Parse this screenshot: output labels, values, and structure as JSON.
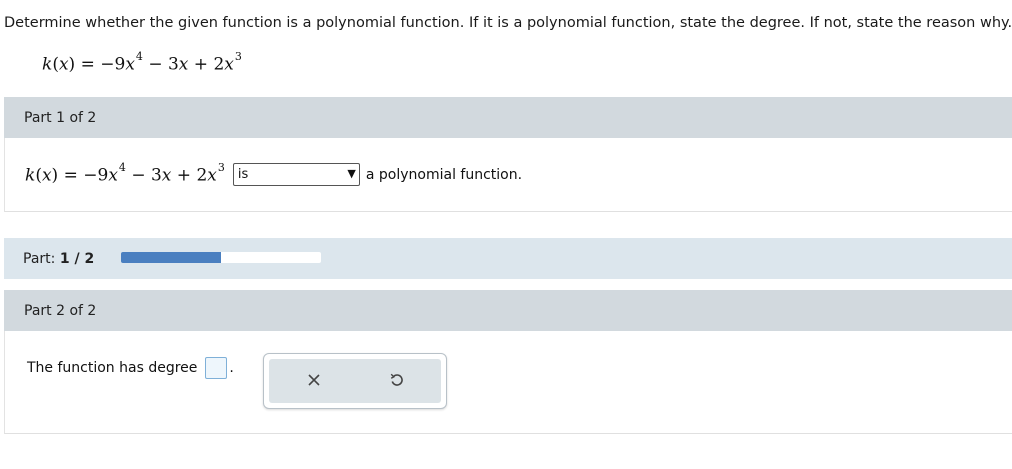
{
  "prompt": "Determine whether the given function is a polynomial function. If it is a polynomial function, state the degree. If not, state the reason why.",
  "equation": {
    "lhs_fn": "k",
    "lhs_var": "x",
    "equals": "=",
    "coef1": "−9",
    "var1": "x",
    "exp1": "4",
    "op2": "−",
    "coef2": "3",
    "var2": "x",
    "op3": "+",
    "coef3": "2",
    "var3": "x",
    "exp3": "3"
  },
  "part1": {
    "header": "Part 1 of 2",
    "select_value": "is",
    "select_arrow": "▼",
    "after_text": "a polynomial function."
  },
  "progress": {
    "label": "Part:",
    "current": "1",
    "sep": "/",
    "total": "2",
    "fraction": 0.5,
    "fill_color": "#4a7fc0"
  },
  "part2": {
    "header": "Part 2 of 2",
    "degree_text": "The function has degree",
    "period": ".",
    "tools": [
      "clear-icon",
      "undo-icon"
    ]
  }
}
